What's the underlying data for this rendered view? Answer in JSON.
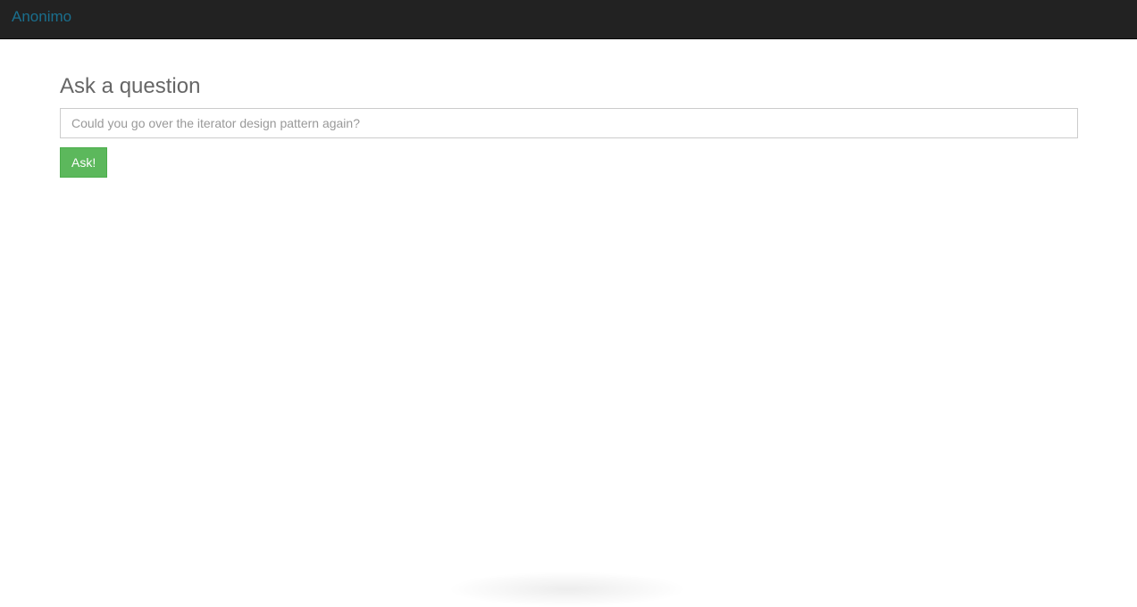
{
  "navbar": {
    "brand": "Anonimo"
  },
  "main": {
    "heading": "Ask a question",
    "question_input": {
      "value": "",
      "placeholder": "Could you go over the iterator design pattern again?"
    },
    "ask_button_label": "Ask!"
  },
  "colors": {
    "navbar_bg": "#222222",
    "brand_link": "#1a6f8e",
    "button_success": "#5cb85c"
  }
}
